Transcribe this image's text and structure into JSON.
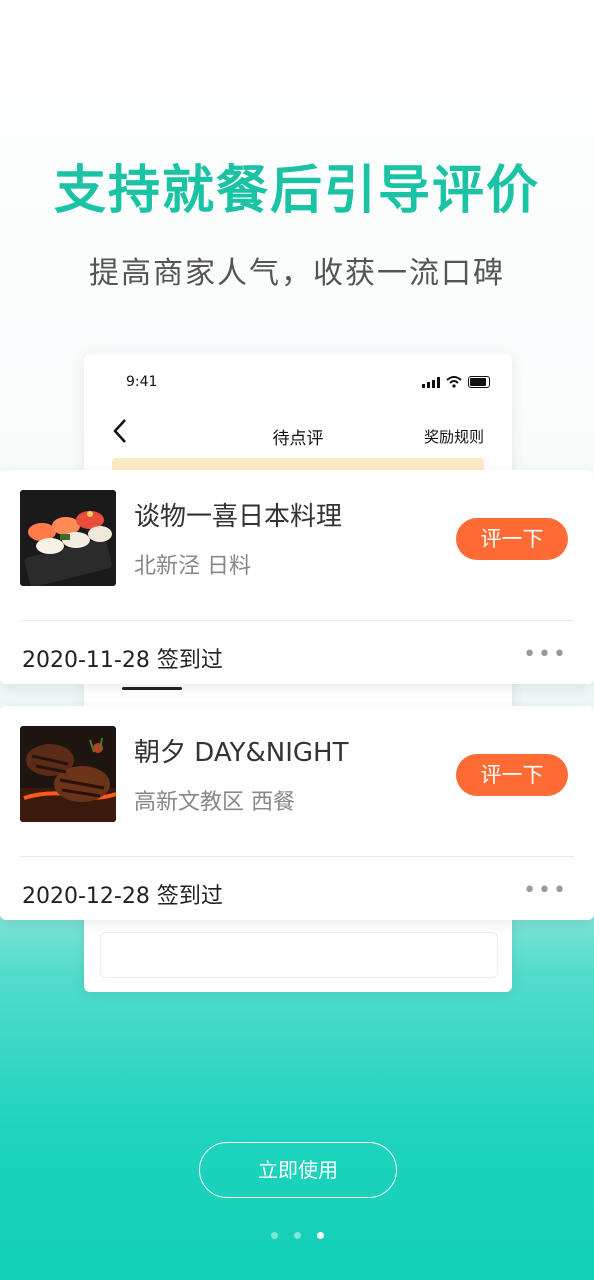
{
  "hero": {
    "headline": "支持就餐后引导评价",
    "subline": "提高商家人气，收获一流口碑"
  },
  "phone": {
    "status_time": "9:41",
    "nav_title": "待点评",
    "nav_right": "奖励规则"
  },
  "cards": [
    {
      "name": "谈物一喜日本料理",
      "meta": "北新泾 日料",
      "button": "评一下",
      "date": "2020-11-28 签到过",
      "more": "•••"
    },
    {
      "name": "朝夕 DAY&NIGHT",
      "meta": "高新文教区 西餐",
      "button": "评一下",
      "date": "2020-12-28 签到过",
      "more": "•••"
    }
  ],
  "cta": {
    "label": "立即使用"
  },
  "pager": {
    "count": 3,
    "active": 3
  },
  "colors": {
    "accent": "#19c3a4",
    "button": "#ff6b35",
    "teal": "#12cfb6"
  }
}
